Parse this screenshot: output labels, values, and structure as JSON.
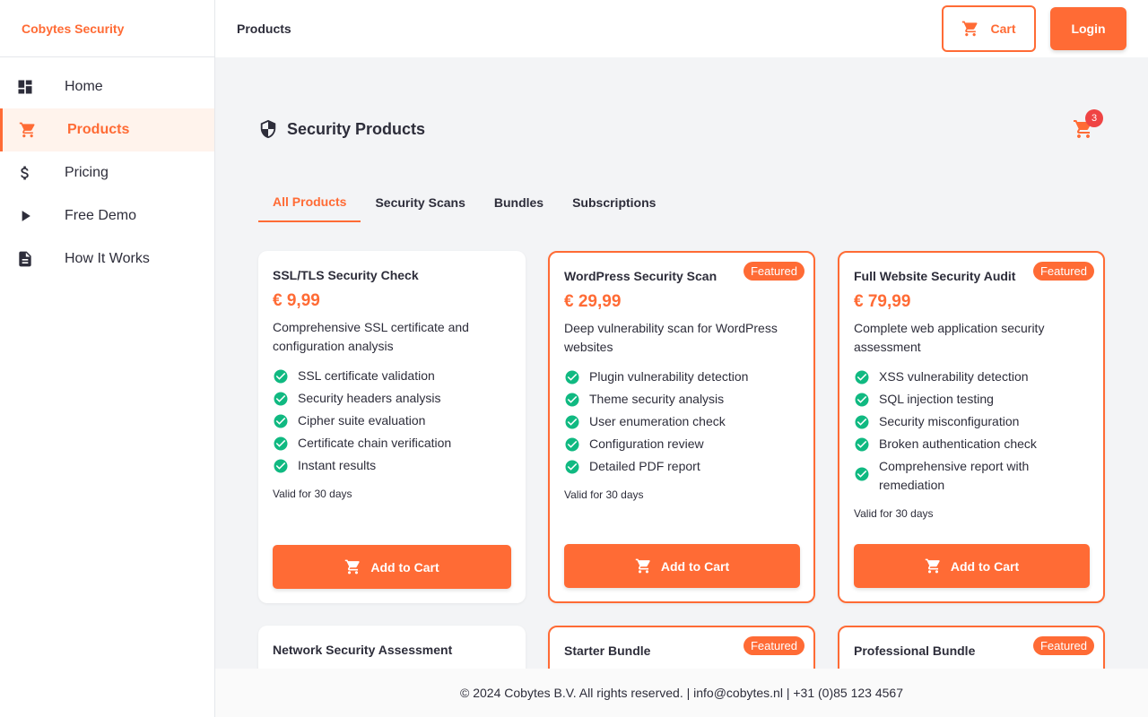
{
  "brand": "Cobytes Security",
  "sidebar": {
    "items": [
      {
        "label": "Home",
        "icon": "dashboard-icon"
      },
      {
        "label": "Products",
        "icon": "cart-icon",
        "active": true
      },
      {
        "label": "Pricing",
        "icon": "dollar-icon"
      },
      {
        "label": "Free Demo",
        "icon": "play-icon"
      },
      {
        "label": "How It Works",
        "icon": "document-icon"
      }
    ]
  },
  "header": {
    "title": "Products",
    "cart_label": "Cart",
    "login_label": "Login"
  },
  "main": {
    "title": "Security Products",
    "cart_count": "3",
    "tabs": [
      {
        "label": "All Products",
        "active": true
      },
      {
        "label": "Security Scans"
      },
      {
        "label": "Bundles"
      },
      {
        "label": "Subscriptions"
      }
    ],
    "products": [
      {
        "name": "SSL/TLS Security Check",
        "price": "€ 9,99",
        "description": "Comprehensive SSL certificate and configuration analysis",
        "features": [
          "SSL certificate validation",
          "Security headers analysis",
          "Cipher suite evaluation",
          "Certificate chain verification",
          "Instant results"
        ],
        "validity": "Valid for 30 days",
        "button": "Add to Cart",
        "featured": false
      },
      {
        "name": "WordPress Security Scan",
        "price": "€ 29,99",
        "description": "Deep vulnerability scan for WordPress websites",
        "features": [
          "Plugin vulnerability detection",
          "Theme security analysis",
          "User enumeration check",
          "Configuration review",
          "Detailed PDF report"
        ],
        "validity": "Valid for 30 days",
        "button": "Add to Cart",
        "featured": true,
        "badge": "Featured"
      },
      {
        "name": "Full Website Security Audit",
        "price": "€ 79,99",
        "description": "Complete web application security assessment",
        "features": [
          "XSS vulnerability detection",
          "SQL injection testing",
          "Security misconfiguration",
          "Broken authentication check",
          "Comprehensive report with remediation"
        ],
        "validity": "Valid for 30 days",
        "button": "Add to Cart",
        "featured": true,
        "badge": "Featured"
      },
      {
        "name": "Network Security Assessment",
        "featured": false
      },
      {
        "name": "Starter Bundle",
        "featured": true,
        "badge": "Featured"
      },
      {
        "name": "Professional Bundle",
        "featured": true,
        "badge": "Featured"
      }
    ]
  },
  "footer": {
    "text": "© 2024 Cobytes B.V. All rights reserved. | info@cobytes.nl | +31 (0)85 123 4567"
  },
  "colors": {
    "accent": "#ff6b35",
    "check": "#10b981",
    "badge": "#ef4444"
  }
}
